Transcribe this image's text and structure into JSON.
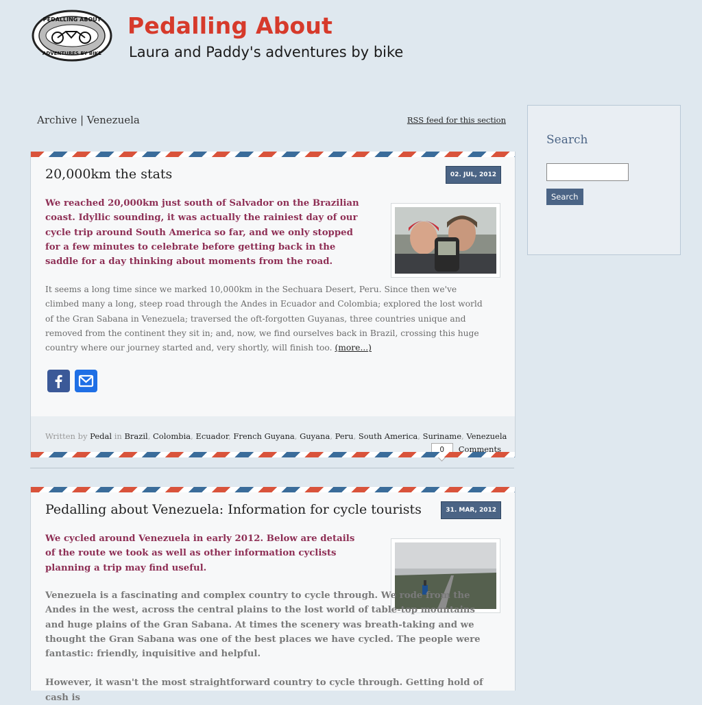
{
  "header": {
    "logo": {
      "top_text": "PEDALLING ABOUT",
      "bottom_text": "ADVENTURES BY BIKE"
    },
    "title": "Pedalling About",
    "tagline": "Laura and Paddy's adventures by bike"
  },
  "archive": {
    "title": "Archive | Venezuela",
    "rss_label": "RSS feed for this section"
  },
  "posts": [
    {
      "title": "20,000km the stats",
      "date": "02. JUL, 2012",
      "lead": "We reached 20,000km just south of Salvador on the Brazilian coast. Idyllic sounding, it was actually the rainiest day of our cycle trip around South America so far, and we only stopped for a few minutes to celebrate before getting back in the saddle for a day thinking about moments from the road.",
      "body": "It seems a long time since we marked 10,000km in the Sechuara Desert, Peru. Since then we've climbed many a long, steep road through the Andes in Ecuador and Colombia; explored the lost world of the Gran Sabana in Venezuela; traversed the oft-forgotten Guyanas, three countries unique and removed from the continent they sit in; and, now, we find ourselves back in Brazil, crossing this huge country where our journey started and, very shortly, will finish too.",
      "more": "(more...)",
      "written_by": "Written by",
      "author": "Pedal",
      "in_label": "in",
      "categories": [
        "Brazil",
        "Colombia",
        "Ecuador",
        "French Guyana",
        "Guyana",
        "Peru",
        "South America",
        "Suriname",
        "Venezuela"
      ],
      "comment_count": "0",
      "comments_label": "Comments"
    },
    {
      "title": "Pedalling about Venezuela: Information for cycle tourists",
      "date": "31. MAR, 2012",
      "lead": "We cycled around Venezuela in early 2012. Below are details of the route we took as well as other information cyclists planning a trip may find useful.",
      "body1": "Venezuela is a fascinating and complex country to cycle through. We rode from the Andes in the west, across the central plains to the lost world of table-top mountains and huge plains of the Gran Sabana. At times the scenery was breath-taking and we thought the Gran Sabana was one of the best places we have cycled. The people were fantastic: friendly, inquisitive and helpful.",
      "body2": "However, it wasn't the most straightforward country to cycle through. Getting hold of cash is"
    }
  ],
  "share": {
    "facebook": "facebook-icon",
    "email": "email-icon"
  },
  "sidebar": {
    "title": "Search",
    "button": "Search"
  },
  "colors": {
    "brand_red": "#d63a2b",
    "accent_blue": "#4b6485",
    "lead_purple": "#8e2f55"
  }
}
